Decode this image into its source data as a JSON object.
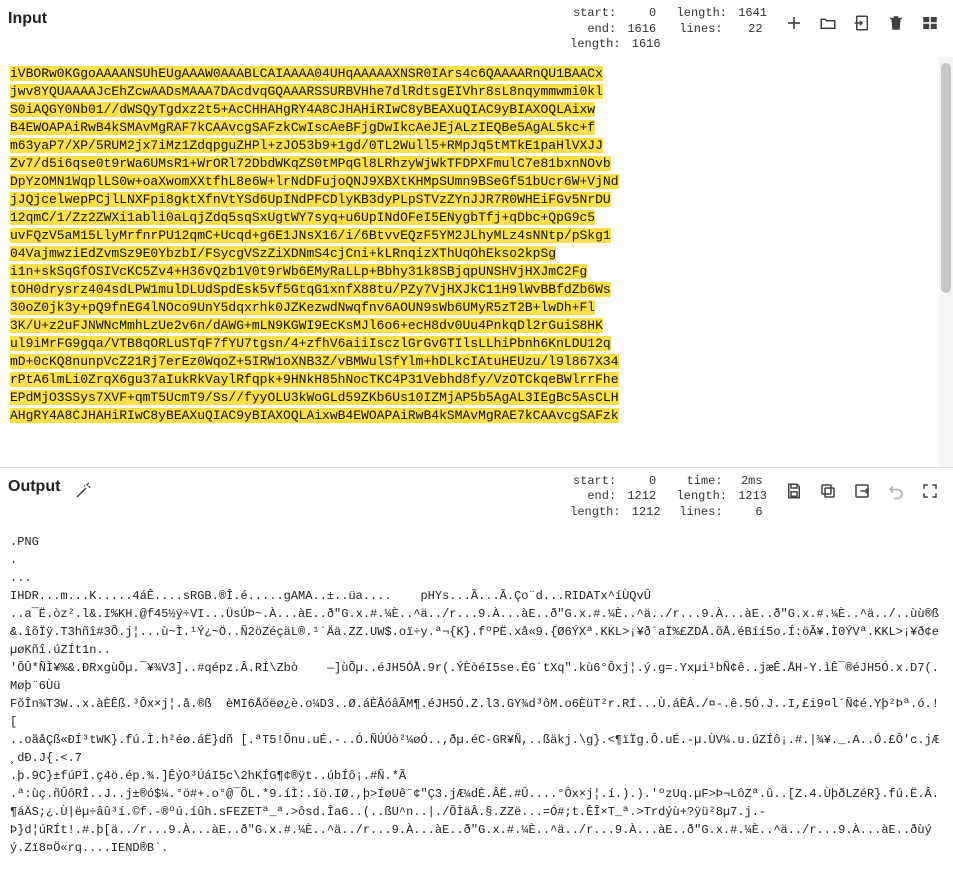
{
  "input": {
    "title": "Input",
    "stats": {
      "start_label": "start:",
      "start": "0",
      "end_label": "end:",
      "end": "1616",
      "length1_label": "length:",
      "length1": "1616",
      "length2_label": "length:",
      "length2": "1641",
      "lines_label": "lines:",
      "lines": "22"
    },
    "lines": [
      "iVBORw0KGgoAAAANSUhEUgAAAW0AAABLCAIAAAA04UHqAAAAAXNSR0IArs4c6QAAAARnQU1BAACx",
      "jwv8YQUAAAAJcEhZcwAADsMAAA7DAcdvqGQAAARSSURBVHhe7dlRdtsgEIVhr8sL8nqymmwmi0kl",
      "S0iAQGY0Nb01//dWSQyTgdxz2t5+AcCHHAHgRY4A8CJHAHiRIwC8yBEAXuQIAC9yBIAXOQLAixw",
      "B4EWOAPAiRwB4kSMAvMgRAF7kCAAvcgSAFzkCwIscAeBFjgDwIkcAeJEjALzIEQBe5AgAL5kc+f",
      "m63yaP7/XP/5RUM2jx7iMz1ZdqpguZHPl+zJO53b9+1gd/0TL2Wull5+RMpJq5tMTkE1paHlVXJJ",
      "Zv7/d5i6qse0t9rWa6UMsR1+WrORl72DbdWKqZS0tMPqGl8LRhzyWjWkTFDPXFmulC7e81bxnNOvb",
      "DpYzOMN1WqplLS0w+oaXwomXXtfhL8e6W+lrNdDFujoQNJ9XBXtKHMpSUmn9BSeGf51bUcr6W+VjNd",
      "jJQjcelwepPCjlLNXFpi8gktXfnVtYSd6UpINdPFCDlyKB3dyPLpSTVzZYnJJR7R0WHEiFGv5NrDU",
      "12qmC/1/Zz2ZWXi1abli0aLqjZdq5sqSxUgtWY7syq+u6UpINdOFeI5ENygbTfj+qDbc+QpG9c5",
      "uvFQzV5aM15LlyMrfnrPU12qmC+Ucqd+g6E1JNsX16/i/6BtvvEQzF5YM2JLhyMLz4sNNtp/pSkg1",
      "04VajmwziEdZvmSz9E0YbzbI/FSycgVSzZiXDNmS4cjCni+kLRnqizXThUqOhEkso2kpSg",
      "i1n+skSqGfOSIVcKC5Zv4+H36vQzb1V0t9rWb6EMyRaLLp+Bbhy31k8SBjqpUNSHVjHXJmC2Fg",
      "tOH0drysrz404sdLPW1mulDLUdSpdEsk5vf5GtqG1xnfX88tu/PZy7VjHXJkC11H9lWvBBfdZb6Ws",
      "30oZ0jk3y+pQ9fnEG4lNOco9UnY5dqxrhk0JZKezwdNwqfnv6AOUN9sWb6UMyR5zT2B+lwDh+Fl",
      "3K/U+z2uFJNWNcMmhLzUe2v6n/dAWG+mLN9KGWI9EcKsMJl6o6+ecH8dv0Uu4PnkqDl2rGuiS8HK",
      "ul9iMrFG9gqa/VTB8qORLuSTqF7fYU7tgsn/4+zfhV6aiiIsczlGrGvGTIlsLLhiPbnh6KnLDU12q",
      "mD+0cKQ8nunpVcZ21Rj7erEz0WqoZ+5IRW1oXNB3Z/vBMWulSfYlm+hDLkcIAtuHEUzu/l9l867X34",
      "rPtA6lmLi0ZrqX6gu37aIukRkVaylRfqpk+9HNkH85hNocTKC4P31Vebhd8fy/VzOTCkqeBWlrrFhe",
      "EPdMjO3SSys7XVF+qmT5UcmT9/Ss//fyyOLU3kWoGLd59ZKb6Us10IZMjAP5b5AgAL3IEgBc5AsCLH",
      "AHgRY4A8CJHAHiRIwC8yBEAXuQIAC9yBIAXOQLAixwB4EWOAPAiRwB4kSMAvMgRAE7kCAAvcgSAFzk"
    ],
    "icons": {
      "add": "add-icon",
      "open": "folder-open-icon",
      "import": "file-import-icon",
      "delete": "trash-icon",
      "grid": "grid-icon"
    }
  },
  "output": {
    "title": "Output",
    "stats": {
      "start_label": "start:",
      "start": "0",
      "end_label": "end:",
      "end": "1212",
      "length1_label": "length:",
      "length1": "1212",
      "time_label": "time:",
      "time": "2ms",
      "length2_label": "length:",
      "length2": "1213",
      "lines_label": "lines:",
      "lines": "6"
    },
    "text": ".PNG\n.\n...\nIHDR...m...K.....4áÊ....sRGB.®Î.é.....gAMA..±..üa....    pHYs...Ã...Ã.Ço¨d...RIDATx^íÙQvÛ\n..a¯Ë.òz².l&.I%KH.@f45½ÿ÷VI...ÜsÚÞ~.À...àE..ð\"G.x.#.¼È..^ä../r...9.À...àE..ð\"G.x.#.¼È..^ä../r...9.À...àE..ð\"G.x.#.¼È..^ä../..ùù®ß&.îõÏÿ.T3hñî#3Õ.j¦...ù~Ì.¹Ý¿~Ö..Ñ2öZéçäL®.¹´Ää.ZZ.UW$.oï÷y.ª¬{K}.fºPË.xå«9.{Ø6ÝXª.KKL>¡¥ð´aÏ%£ZDÅ.õÅ.éBíí5o.Í:öÃ¥.Ì0ÝVª.KKL>¡¥ð¢eµøKñî.úZÍt1n..\n'ÕÛ*ÑÌ¥%&.ÐRxgùÕµ.¯¥¾V3]..#qépz.Â.RÍ\\Zbò    —]ùÕµ..éJH5ÓÅ.9r(.ÝÈòéI5se.ÉG´tXq\".kù6°Ôxj¦.ý.g=.Yxµi¹bÑ¢ê..jæÊ.ÅH-Y.ìÊ¯®éJH5Ó.x.D7(.Møþ¨6Ùü\nFõÎn¾T3W..x.àÈÊß.³Ôx×j¦.å.®ß  èMI6Åõëø¿è.o¼D3..Ø.áÈÂóâÃM¶.éJH5Ó.Z.l3.GY¾d³ôM.o6ÈüT²r.RÍ...Ù.áÈÂ./¤-.ê.5Ó.J..I,£i9¤l´Ñ¢é.Yþ²Þª.ó.![\n..oãåÇß«ÐÍ³tWK}.fú.Ì.h²éø.áË}dñ [.ªT5!Õnu.uÉ.-..Ó.ÑÚÚò²¼øÓ..,ðµ.éC-GR¥Ñ,..ßäkj.\\g}.<¶ïÏg.Ô.uÉ.-µ.ÙV¼.u.úZÍô¡.#.|¾¥._.A..Ó.£Ô'c.jÆ¸dÐ.J{.<.7\n.þ.9C}±fúPÌ.ç4ö.ép.¾.]ÊýO³ÚáI5c\\2hKÍG¶¢®ÿt..úbÍô¡.#Ñ.*Ã\n.ª:ùç.ñÛôRÎ..J..j±®ó$¼.°ö#+.o°@¯ÕL.*9.íÌ:.íö.IØ.,þ>ÍøUê¨¢\"Ç3.jÆ¼dÈ.ÂË.#Û....°Ôx×j¦.í.).).'ºzUq.µF>Þ¬LôZª.û..[Z.4.ÙþðLZéR}.fú.Ë.Â.¶áÄS;¿.Ù|ëµ÷âû³í.©f.-®ºú.íûh.sFEZETª_ª.>ôsd.Îa6..(..ßU^n..|./ÕÌäÂ.§.ZZë...=Ó#;t.ÊÎ×T_ª.>Trdýù+?ÿü²8µ7.j.-\nÞ}d¦úRÍt!.#.þ[ä../r...9.À...àE..ð\"G.x.#.¼È..^ä../r...9.À...àE..ð\"G.x.#.¼È..^ä../r...9.À...àE..ð\"G.x.#.¼È..^ä../r...9.À...àE..ðùýý.Zï8¤Ö«rq....IEND®B`.",
    "icons": {
      "wand": "magic-wand-icon",
      "save": "save-icon",
      "copy": "copy-icon",
      "export": "export-icon",
      "undo": "undo-icon",
      "fullscreen": "fullscreen-icon"
    }
  }
}
